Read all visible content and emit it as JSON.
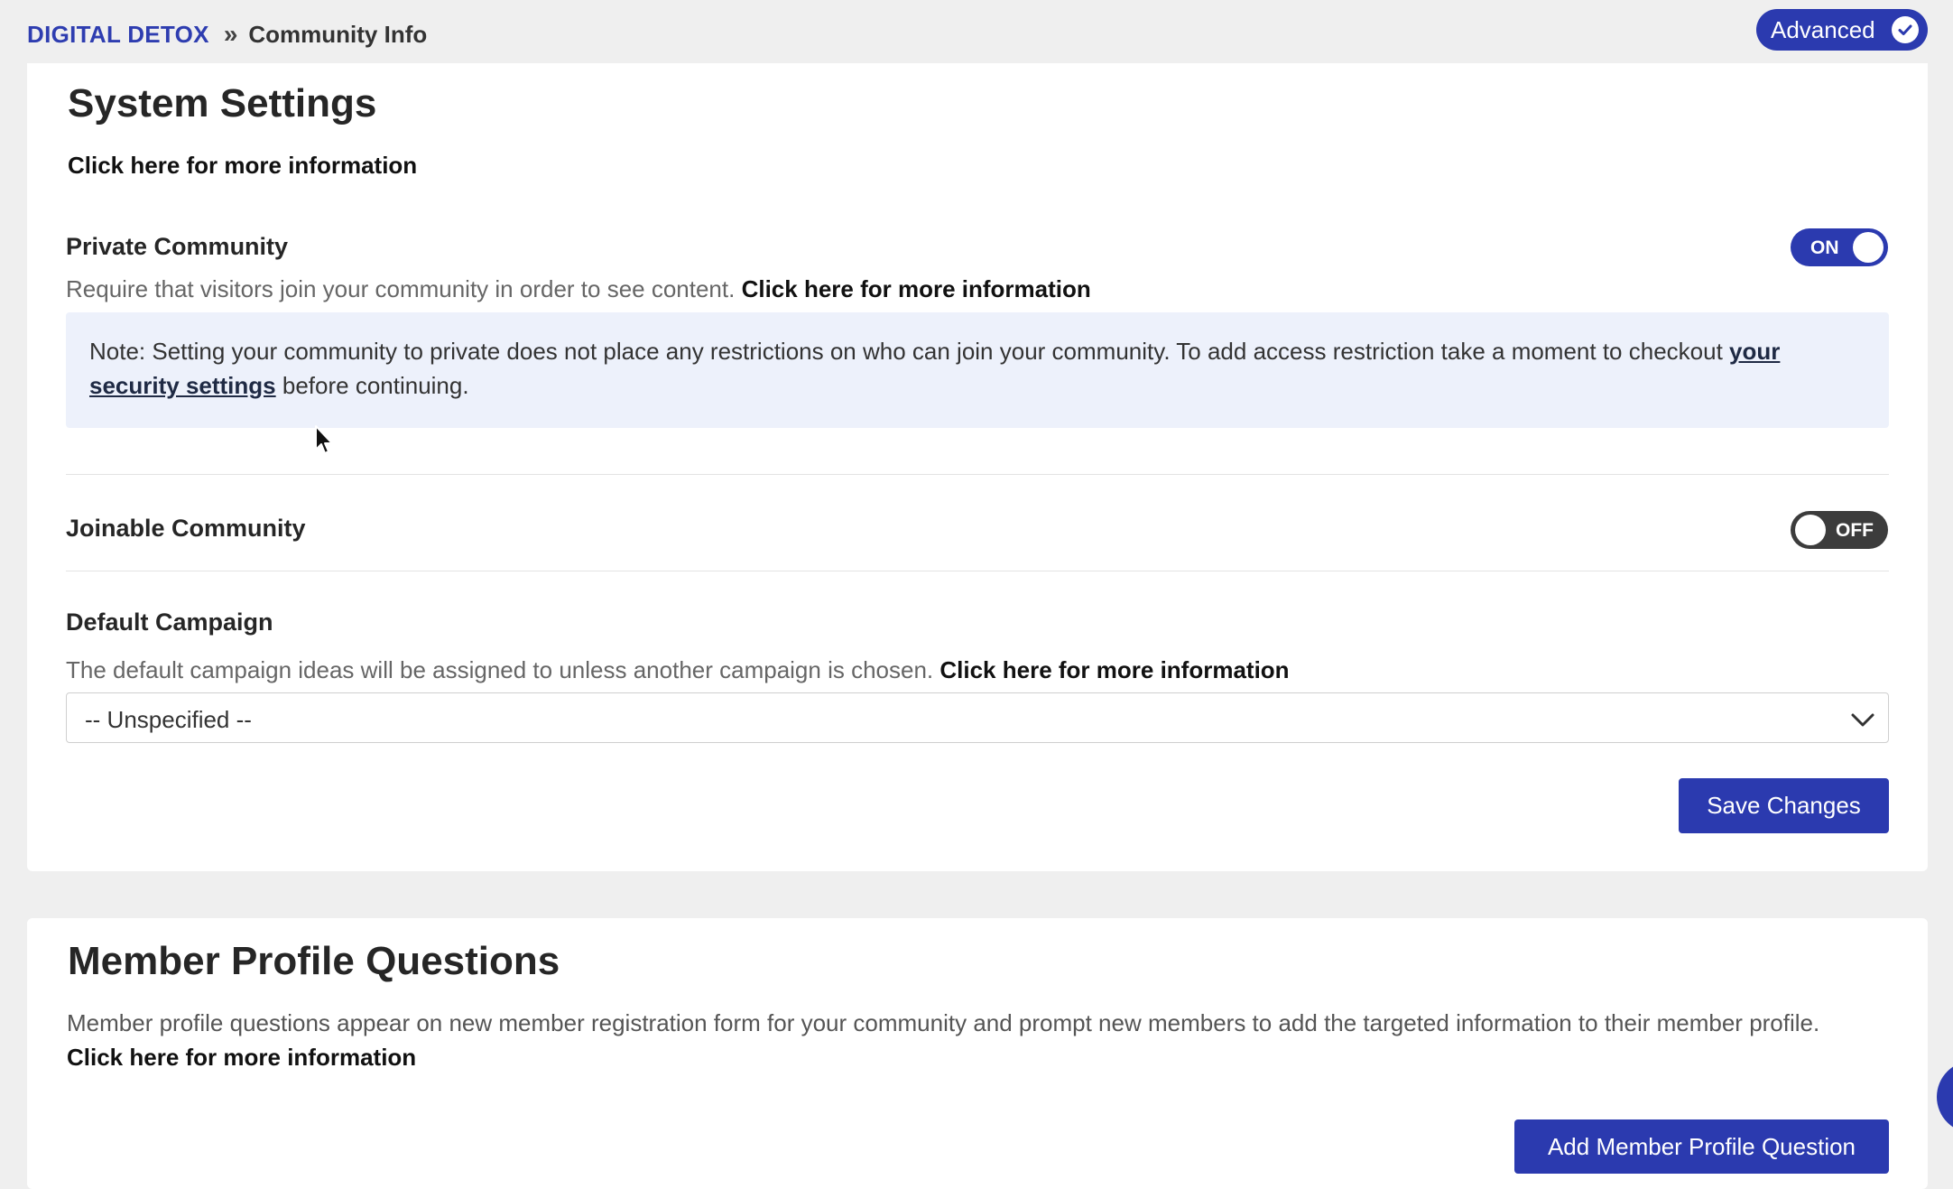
{
  "breadcrumb": {
    "home": "DIGITAL DETOX",
    "separator": "»",
    "current": "Community Info"
  },
  "header": {
    "advanced_label": "Advanced",
    "advanced_checked": true
  },
  "system_settings": {
    "title": "System Settings",
    "more_info": "Click here for more information",
    "private_community": {
      "title": "Private Community",
      "description": "Require that visitors join your community in order to see content.",
      "more_info": "Click here for more information",
      "toggle_label": "ON",
      "enabled": true,
      "note_prefix": "Note: Setting your community to private does not place any restrictions on who can join your community. To add access restriction take a moment to checkout",
      "note_link": "your security settings",
      "note_suffix": "before continuing."
    },
    "joinable_community": {
      "title": "Joinable Community",
      "toggle_label": "OFF",
      "enabled": false
    },
    "default_campaign": {
      "title": "Default Campaign",
      "description": "The default campaign ideas will be assigned to unless another campaign is chosen.",
      "more_info": "Click here for more information",
      "selected": "-- Unspecified --"
    },
    "save_label": "Save Changes"
  },
  "member_profile": {
    "title": "Member Profile Questions",
    "description": "Member profile questions appear on new member registration form for your community and prompt new members to add the targeted information to their member profile.",
    "more_info": "Click here for more information",
    "add_label": "Add Member Profile Question"
  },
  "colors": {
    "accent": "#2b3aaf",
    "note_bg": "#edf1fb",
    "page_bg": "#efefef"
  }
}
